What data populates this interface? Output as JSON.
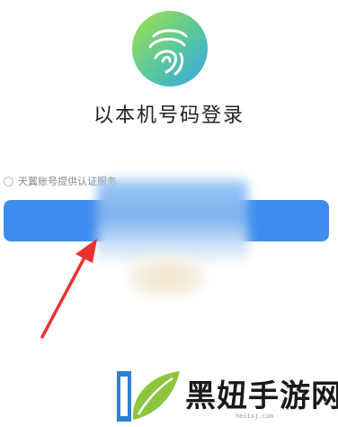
{
  "login": {
    "title": "以本机号码登录",
    "provider_text": "天翼账号提供认证服务"
  },
  "watermark": {
    "text": "黑妞手游网",
    "url": "heitsj.com"
  },
  "colors": {
    "button": "#3f8cef",
    "arrow": "#e8332f",
    "logo_gradient": [
      "#a6df49",
      "#58c6a0",
      "#38a6e6"
    ]
  },
  "icons": {
    "logo": "fingerprint-icon",
    "provider_check": "radio-circle-icon",
    "watermark_logo": "leaf-logo-icon"
  }
}
